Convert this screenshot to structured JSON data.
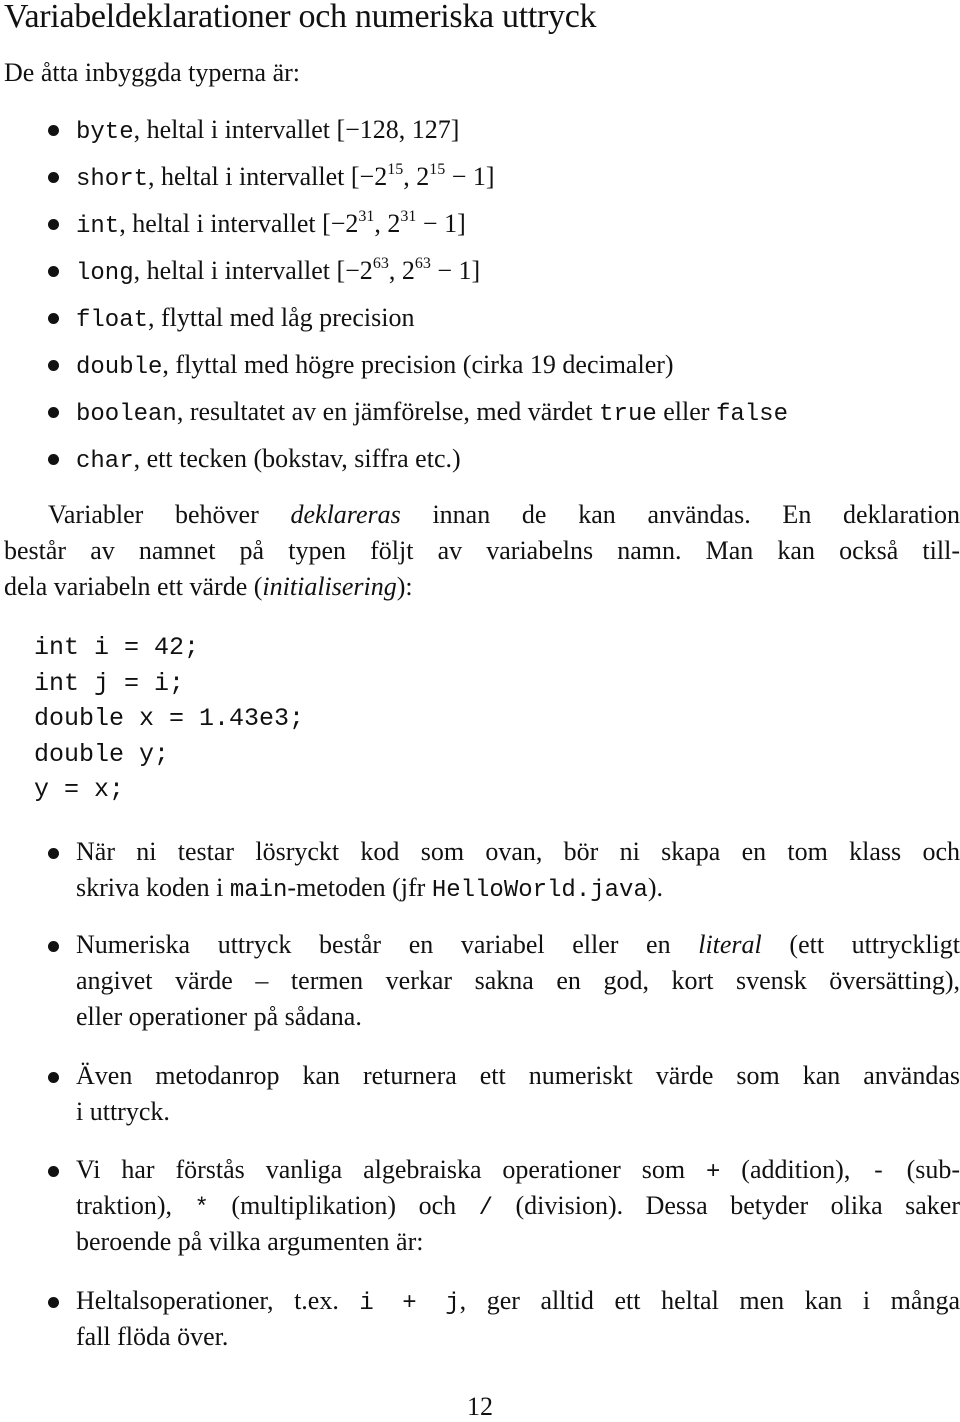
{
  "title": "Variabeldeklarationer och numeriska uttryck",
  "intro": "De åtta inbyggda typerna är:",
  "types": [
    {
      "name": "byte",
      "description": ", heltal i intervallet [−128, 127]"
    },
    {
      "name": "short",
      "description_prefix": ", heltal i intervallet [−2",
      "exp1": "15",
      "mid": ", 2",
      "exp2": "15",
      "suffix": " − 1]"
    },
    {
      "name": "int",
      "description_prefix": ", heltal i intervallet [−2",
      "exp1": "31",
      "mid": ", 2",
      "exp2": "31",
      "suffix": " − 1]"
    },
    {
      "name": "long",
      "description_prefix": ", heltal i intervallet [−2",
      "exp1": "63",
      "mid": ", 2",
      "exp2": "63",
      "suffix": " − 1]"
    },
    {
      "name": "float",
      "description": ", flyttal med låg precision"
    },
    {
      "name": "double",
      "description": ", flyttal med högre precision (cirka 19 decimaler)"
    },
    {
      "name": "boolean",
      "description": ", resultatet av en jämförelse, med värdet ",
      "code2": "true",
      "mid": " eller ",
      "code3": "false"
    },
    {
      "name": "char",
      "description": ", ett tecken (bokstav, siffra etc.)"
    }
  ],
  "paragraph": {
    "l1_pre": "Variabler behöver ",
    "l1_em": "deklareras",
    "l1_post": " innan de kan användas. En deklaration",
    "l2": "består av namnet på typen följt av variabelns namn. Man kan också till-",
    "l3_pre": "dela variabeln ett värde (",
    "l3_em": "initialisering",
    "l3_post": "):"
  },
  "code": [
    "int i = 42;",
    "int j = i;",
    "double x = 1.43e3;",
    "double y;",
    "y = x;"
  ],
  "notes": {
    "n1": {
      "l1": "När ni testar lösryckt kod som ovan, bör ni skapa en tom klass och",
      "l2_pre": "skriva koden i ",
      "l2_code1": "main",
      "l2_mid": "-metoden (jfr ",
      "l2_code2": "HelloWorld.java",
      "l2_post": ")."
    },
    "n2": {
      "l1_pre": "Numeriska uttryck består en variabel eller en ",
      "l1_em": "literal",
      "l1_post": " (ett uttryckligt",
      "l2": "angivet värde – termen verkar sakna en god, kort svensk översätting),",
      "l3": "eller operationer på sådana."
    },
    "n3": {
      "l1": "Även metodanrop kan returnera ett numeriskt värde som kan användas",
      "l2": "i uttryck."
    },
    "n4": {
      "l1_pre": "Vi har förstås vanliga algebraiska operationer som ",
      "op_plus": "+",
      "l1_a": " (addition), ",
      "op_minus": "-",
      "l1_b": " (sub-",
      "l2_pre": "traktion), ",
      "op_mul": "*",
      "l2_a": " (multiplikation) och ",
      "op_div": "/",
      "l2_b": " (division). Dessa betyder olika saker",
      "l3": "beroende på vilka argumenten är:"
    },
    "n5": {
      "l1_pre": "Heltalsoperationer, t.ex. ",
      "l1_code": "i + j",
      "l1_post": ", ger alltid ett heltal men kan i många",
      "l2": "fall flöda över."
    }
  },
  "page_number": "12"
}
